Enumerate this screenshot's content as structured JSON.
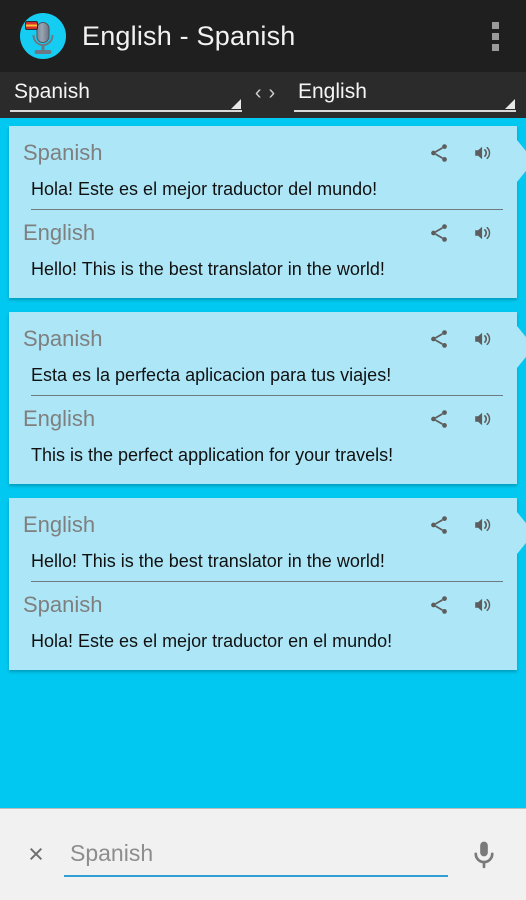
{
  "actionbar": {
    "title": "English - Spanish",
    "app_icon_name": "app-microphone-icon",
    "overflow_label": "⋮"
  },
  "langbar": {
    "source_language": "Spanish",
    "target_language": "English",
    "swap_prev": "‹",
    "swap_next": "›"
  },
  "conversation": [
    {
      "segments": [
        {
          "language": "Spanish",
          "text": "Hola! Este es el mejor traductor del mundo!",
          "divider": true
        },
        {
          "language": "English",
          "text": "Hello! This is the best translator in the world!",
          "divider": false
        }
      ]
    },
    {
      "segments": [
        {
          "language": "Spanish",
          "text": "Esta es la perfecta aplicacion para tus viajes!",
          "divider": true
        },
        {
          "language": "English",
          "text": "This is the perfect application for your travels!",
          "divider": false
        }
      ]
    },
    {
      "segments": [
        {
          "language": "English",
          "text": "Hello! This is the best translator in the world!",
          "divider": true
        },
        {
          "language": "Spanish",
          "text": "Hola! Este es el mejor traductor en el mundo!",
          "divider": false
        }
      ]
    }
  ],
  "inputbar": {
    "clear_label": "×",
    "input_value": "",
    "input_placeholder": "Spanish",
    "mic_label": "microphone"
  },
  "colors": {
    "background": "#00c8f0",
    "card": "#ade7f7",
    "actionbar": "#1f1f1f",
    "langbar": "#2b2b2b",
    "accent_underline": "#2f9fd4",
    "label_gray": "#7f7f7f"
  }
}
